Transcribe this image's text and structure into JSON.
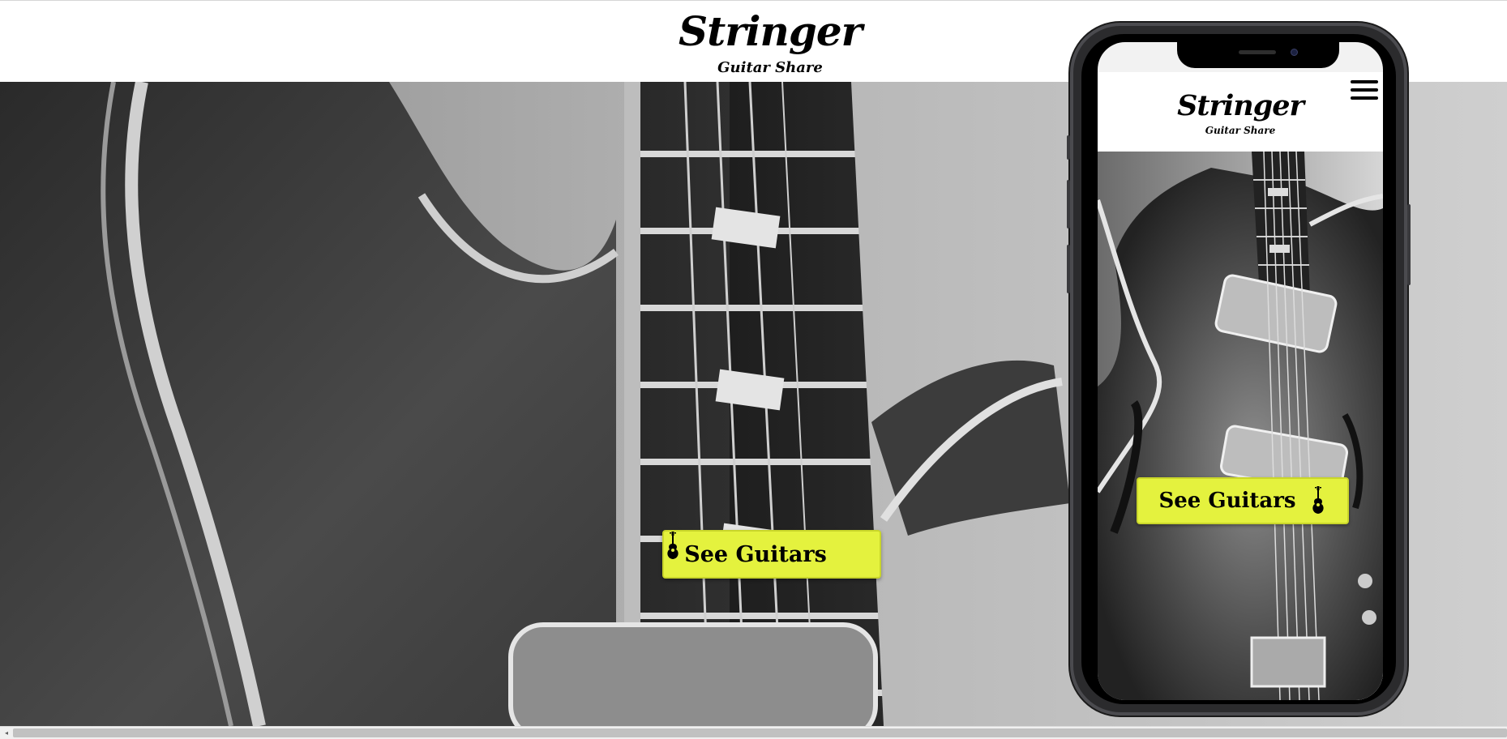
{
  "header": {
    "title": "Stringer",
    "subtitle": "Guitar Share"
  },
  "hero": {
    "cta_label": "See Guitars",
    "cta_icon": "guitar-icon",
    "image": "black-and-white-guitar-closeup"
  },
  "phone": {
    "title": "Stringer",
    "subtitle": "Guitar Share",
    "menu_icon": "hamburger-menu-icon",
    "cta_label": "See Guitars",
    "cta_icon": "guitar-icon"
  },
  "colors": {
    "accent": "#e4f23e",
    "text": "#000000",
    "background": "#ffffff"
  },
  "scrollbar": {
    "arrow_left": "◂"
  }
}
